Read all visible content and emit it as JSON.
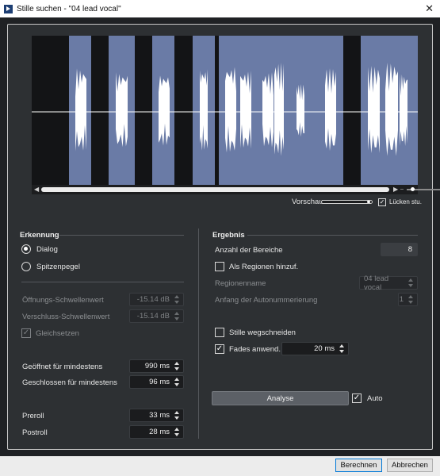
{
  "window": {
    "title": "Stille suchen - \"04 lead vocal\"",
    "close_glyph": "✕",
    "app_icon": "play-icon"
  },
  "waveform": {
    "regions": 8,
    "preview_label": "Vorschau",
    "gaps_label": "Lücken stu.",
    "gaps_checked": true,
    "preview_level": 0.9,
    "colors": {
      "background": "#131416",
      "region": "#6a7ba6",
      "wave": "#ffffff"
    }
  },
  "detection": {
    "title": "Erkennung",
    "mode_dialog": "Dialog",
    "mode_peak": "Spitzenpegel",
    "selected_mode": "Dialog",
    "open_threshold_label": "Öffnungs-Schwellenwert",
    "open_threshold_value": "-15.14 dB",
    "close_threshold_label": "Verschluss-Schwellenwert",
    "close_threshold_value": "-15.14 dB",
    "equalize_label": "Gleichsetzen",
    "equalize_checked": true,
    "min_open_label": "Geöffnet für mindestens",
    "min_open_value": "990 ms",
    "min_closed_label": "Geschlossen für mindestens",
    "min_closed_value": "96 ms",
    "preroll_label": "Preroll",
    "preroll_value": "33 ms",
    "postroll_label": "Postroll",
    "postroll_value": "28 ms"
  },
  "result": {
    "title": "Ergebnis",
    "count_label": "Anzahl der Bereiche",
    "count_value": "8",
    "as_regions_label": "Als Regionen hinzuf.",
    "as_regions_checked": false,
    "region_name_label": "Regionenname",
    "region_name_value": "04 lead vocal",
    "numbering_label": "Anfang der Autonummerierung",
    "numbering_value": "1",
    "cut_silence_label": "Stille wegschneiden",
    "cut_silence_checked": false,
    "fades_label": "Fades anwend.",
    "fades_checked": true,
    "fades_value": "20 ms",
    "analyse_label": "Analyse",
    "auto_label": "Auto",
    "auto_checked": true
  },
  "footer": {
    "calculate_label": "Berechnen",
    "cancel_label": "Abbrechen"
  }
}
